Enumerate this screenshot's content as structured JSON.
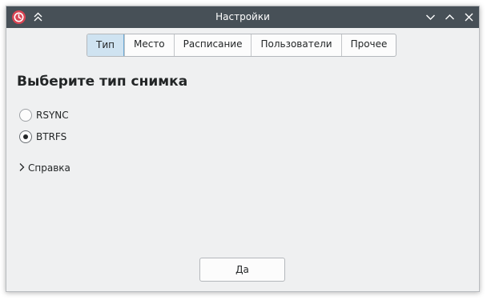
{
  "window": {
    "title": "Настройки",
    "app_icon": "timeshift-app-icon",
    "buttons": [
      "keep-above-icon",
      "minimize-icon",
      "maximize-icon",
      "close-icon"
    ]
  },
  "tabs": [
    {
      "label": "Тип",
      "active": true
    },
    {
      "label": "Место",
      "active": false
    },
    {
      "label": "Расписание",
      "active": false
    },
    {
      "label": "Пользователи",
      "active": false
    },
    {
      "label": "Прочее",
      "active": false
    }
  ],
  "content": {
    "heading": "Выберите тип снимка",
    "options": [
      {
        "label": "RSYNC",
        "selected": false
      },
      {
        "label": "BTRFS",
        "selected": true
      }
    ],
    "help_label": "Справка"
  },
  "footer": {
    "ok_label": "Да"
  },
  "colors": {
    "titlebar": "#475057",
    "window_bg": "#eff0f1",
    "active_tab_bg": "#cfe3f1",
    "active_tab_border": "#6ca8d3",
    "app_icon": "#da4453"
  }
}
